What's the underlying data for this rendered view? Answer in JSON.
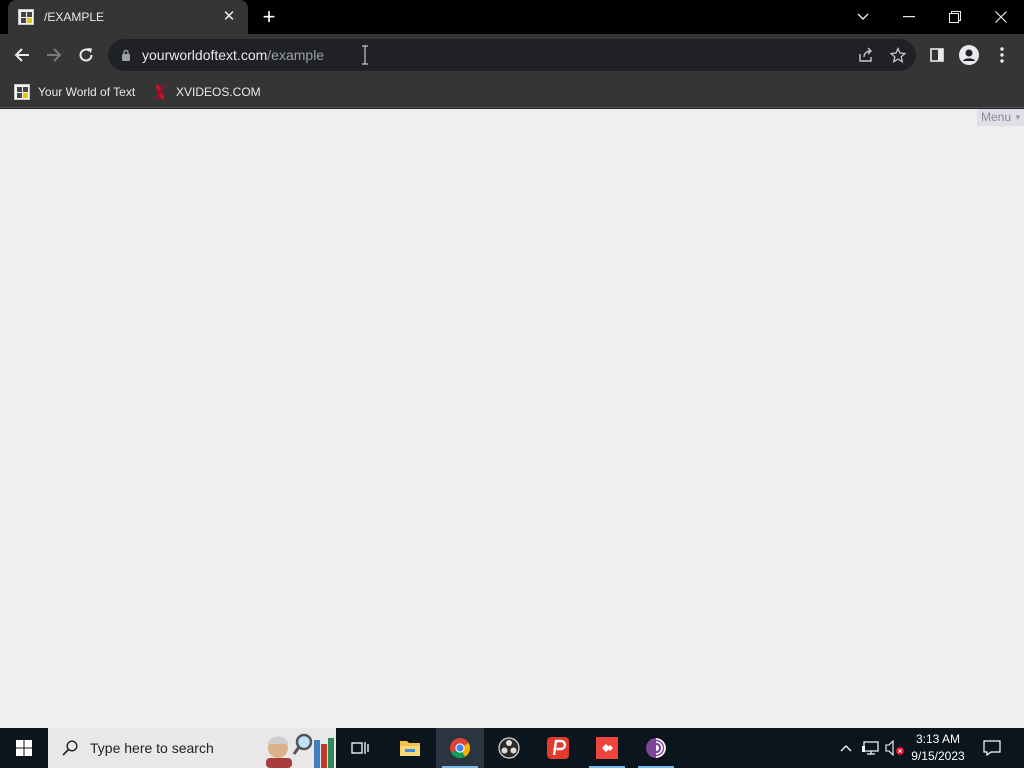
{
  "browser": {
    "tab": {
      "title": "/EXAMPLE",
      "favicon": "ywot-favicon"
    },
    "window_controls": [
      "tab-search",
      "minimize",
      "restore",
      "close"
    ],
    "omnibox": {
      "host": "yourworldoftext.com",
      "path": "/example"
    },
    "bookmarks": [
      {
        "label": "Your World of Text",
        "icon": "ywot-favicon"
      },
      {
        "label": "XVIDEOS.COM",
        "icon": "xvideos-favicon"
      }
    ]
  },
  "page": {
    "menu_label": "Menu",
    "menu_arrow": "▼",
    "background": "#efefef"
  },
  "taskbar": {
    "search_placeholder": "Type here to search",
    "apps": [
      "task-view",
      "file-explorer",
      "chrome",
      "obs-studio",
      "psiphon",
      "anydesk",
      "tor-browser"
    ],
    "active_app": "chrome",
    "time": "3:13 AM",
    "date": "9/15/2023"
  },
  "colors": {
    "tab_strip": "#000000",
    "toolbar": "#353535",
    "omnibox": "#202124",
    "taskbar": "#0b151d",
    "accent": "#76b9ed"
  }
}
